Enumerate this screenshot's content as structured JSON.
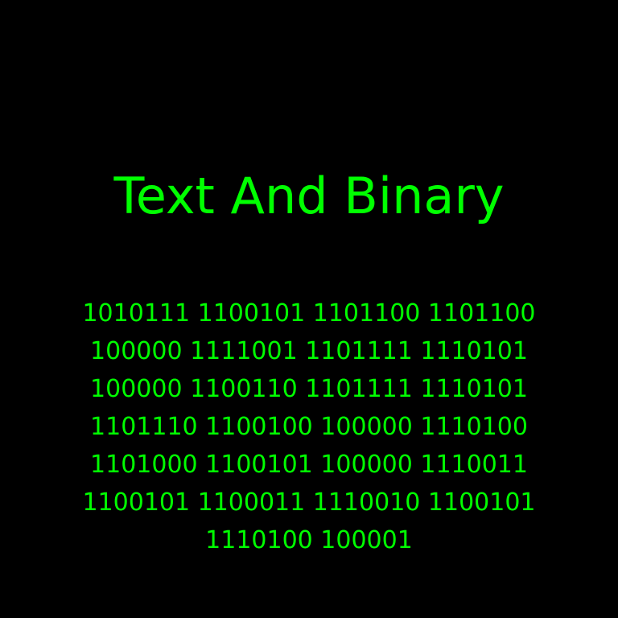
{
  "theme": {
    "background": "#000000",
    "text_color": "#00ff00"
  },
  "title": "Text And Binary",
  "binary_lines": [
    "1010111 1100101 1101100 1101100",
    "100000 1111001 1101111 1110101",
    "100000 1100110 1101111 1110101",
    "1101110 1100100 100000 1110100",
    "1101000 1100101 100000 1110011",
    "1100101 1100011 1110010 1100101",
    "1110100 100001"
  ]
}
